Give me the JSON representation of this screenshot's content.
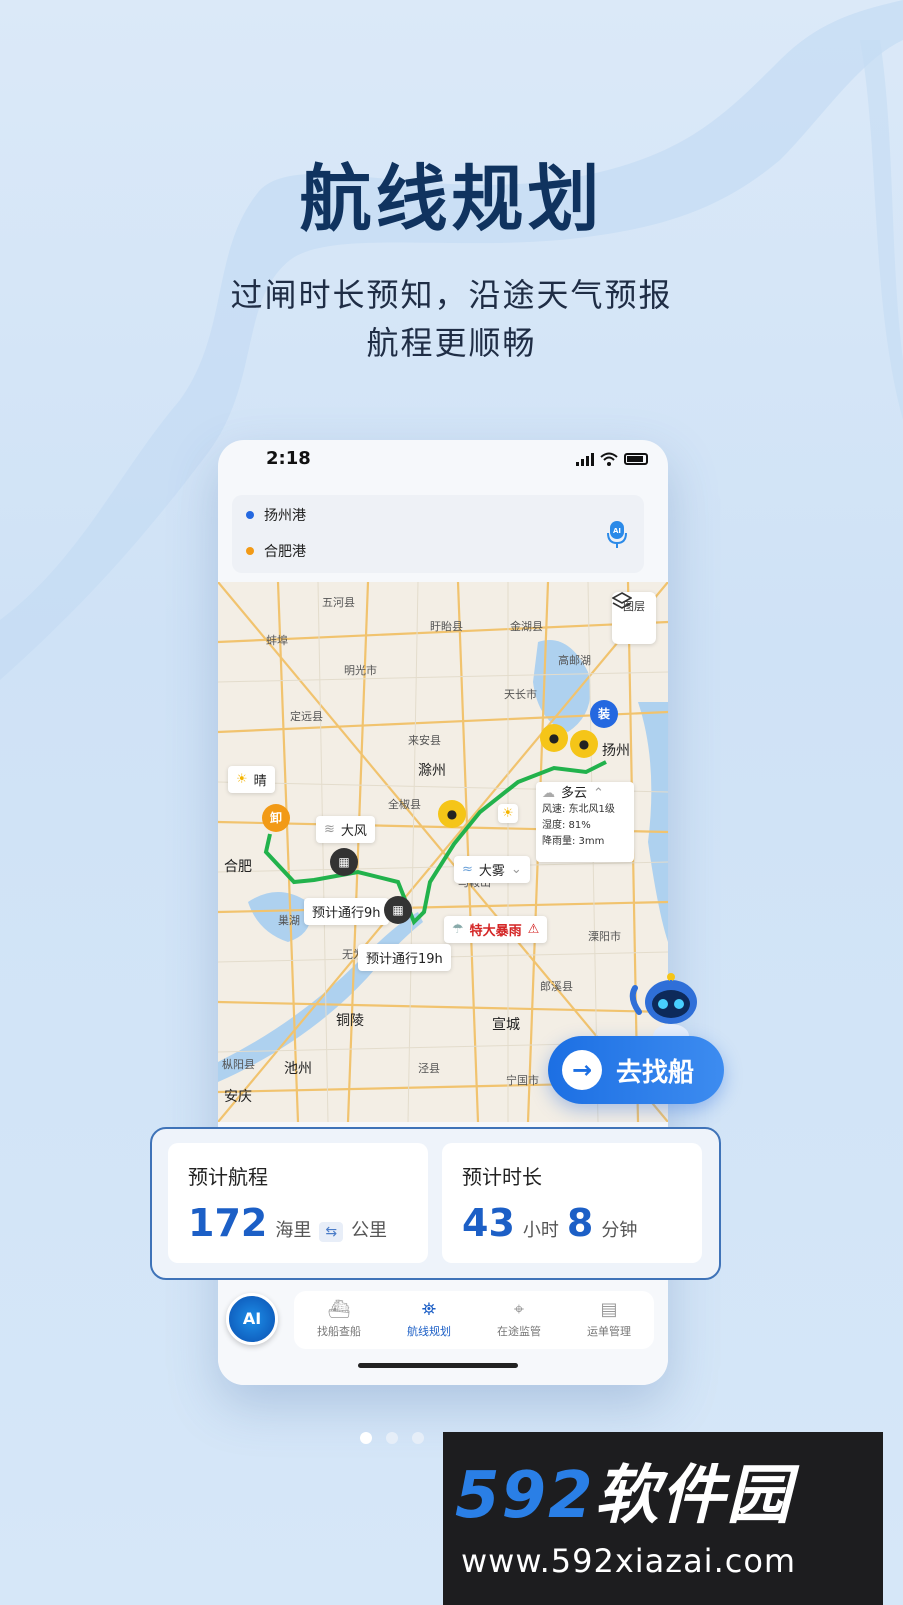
{
  "hero": {
    "title": "航线规划",
    "subtitle_line1": "过闸时长预知，沿途天气预报",
    "subtitle_line2": "航程更顺畅"
  },
  "phone": {
    "status_time": "2:18",
    "route": {
      "origin": "扬州港",
      "destination": "合肥港",
      "origin_color": "#2468e0",
      "destination_color": "#f29a16",
      "mic_label": "AI"
    },
    "map": {
      "layer_button": "图层",
      "labels": [
        "五河县",
        "盱眙县",
        "金湖县",
        "高邮湖",
        "蚌埠",
        "明光市",
        "天长市",
        "定远县",
        "来安县",
        "滁州",
        "全椒县",
        "扬州",
        "合肥",
        "巢湖",
        "马鞍山",
        "无为市",
        "溧阳市",
        "郎溪县",
        "铜陵",
        "宣城",
        "枞阳县",
        "池州",
        "泾县",
        "宁国市",
        "安庆"
      ],
      "pins": {
        "load": "装",
        "unload": "卸"
      },
      "weather_chips": {
        "sunny": "晴",
        "wind": "大风",
        "fog": "大雾",
        "storm": "特大暴雨"
      },
      "weather_card": {
        "title": "多云",
        "wind": "风速: 东北风1级",
        "humidity": "湿度: 81%",
        "rain": "降雨量: 3mm"
      },
      "lock_chips": {
        "lock1": "预计通行9h",
        "lock2": "预计通行19h"
      }
    },
    "find_button": "去找船",
    "stats": {
      "distance_label": "预计航程",
      "distance_value": "172",
      "distance_unit": "海里",
      "distance_alt_unit": "公里",
      "duration_label": "预计时长",
      "hours_value": "43",
      "hours_unit": "小时",
      "minutes_value": "8",
      "minutes_unit": "分钟"
    },
    "tabbar": {
      "ai_label": "AI",
      "tabs": [
        {
          "label": "找船查船",
          "icon": "ship-search-icon"
        },
        {
          "label": "航线规划",
          "icon": "route-map-icon",
          "active": true
        },
        {
          "label": "在途监管",
          "icon": "location-monitor-icon"
        },
        {
          "label": "运单管理",
          "icon": "waybill-icon"
        }
      ]
    }
  },
  "watermark": {
    "digits": "592",
    "text": "软件园",
    "url": "www.592xiazai.com"
  }
}
